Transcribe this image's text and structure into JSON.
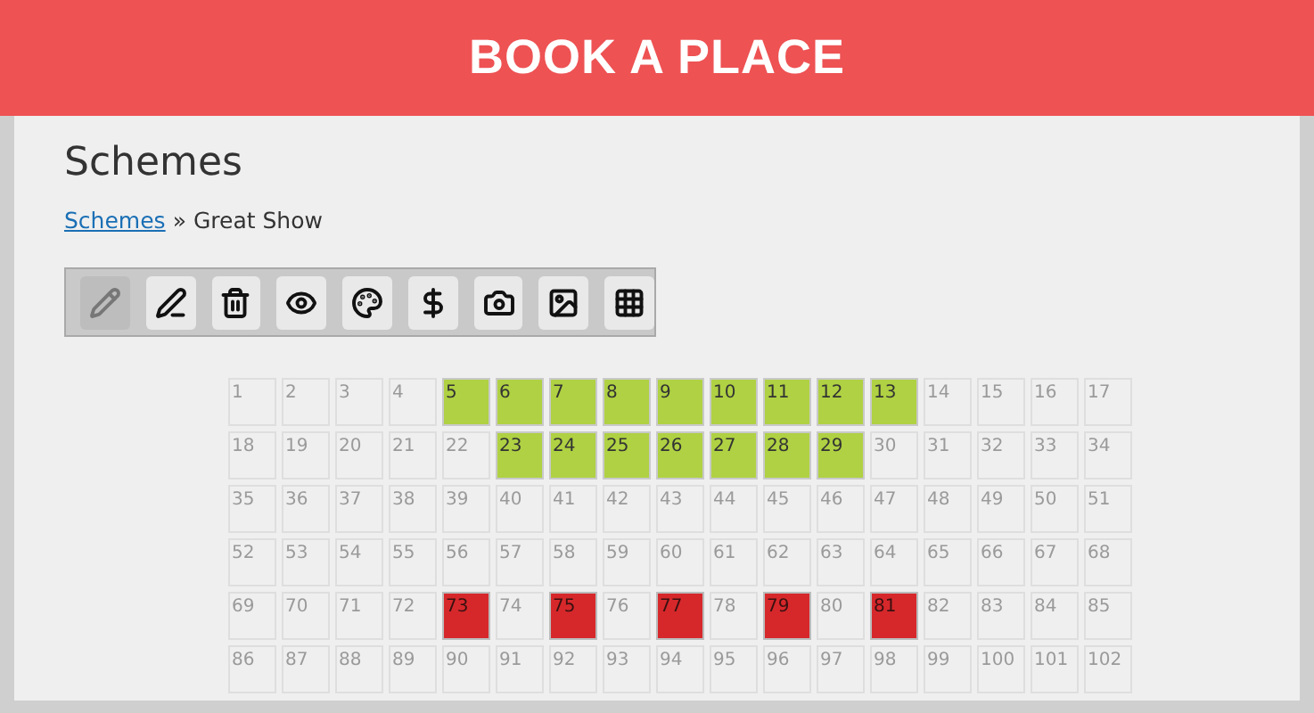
{
  "header": {
    "title": "BOOK A PLACE"
  },
  "page": {
    "heading": "Schemes",
    "breadcrumb": {
      "link": "Schemes",
      "separator": "»",
      "current": "Great Show"
    }
  },
  "toolbar": [
    {
      "kind": "pencil",
      "disabled": true
    },
    {
      "kind": "edit",
      "disabled": false
    },
    {
      "kind": "trash",
      "disabled": false
    },
    {
      "kind": "eye",
      "disabled": false
    },
    {
      "kind": "palette",
      "disabled": false
    },
    {
      "kind": "dollar",
      "disabled": false
    },
    {
      "kind": "camera",
      "disabled": false
    },
    {
      "kind": "image",
      "disabled": false
    },
    {
      "kind": "grid",
      "disabled": false
    }
  ],
  "seats": [
    {
      "label": "1",
      "selected": false,
      "booked": false
    },
    {
      "label": "2",
      "selected": false,
      "booked": false
    },
    {
      "label": "3",
      "selected": false,
      "booked": false
    },
    {
      "label": "4",
      "selected": false,
      "booked": false
    },
    {
      "label": "5",
      "selected": true,
      "booked": false
    },
    {
      "label": "6",
      "selected": true,
      "booked": false
    },
    {
      "label": "7",
      "selected": true,
      "booked": false
    },
    {
      "label": "8",
      "selected": true,
      "booked": false
    },
    {
      "label": "9",
      "selected": true,
      "booked": false
    },
    {
      "label": "10",
      "selected": true,
      "booked": false
    },
    {
      "label": "11",
      "selected": true,
      "booked": false
    },
    {
      "label": "12",
      "selected": true,
      "booked": false
    },
    {
      "label": "13",
      "selected": true,
      "booked": false
    },
    {
      "label": "14",
      "selected": false,
      "booked": false
    },
    {
      "label": "15",
      "selected": false,
      "booked": false
    },
    {
      "label": "16",
      "selected": false,
      "booked": false
    },
    {
      "label": "17",
      "selected": false,
      "booked": false
    },
    {
      "label": "18",
      "selected": false,
      "booked": false
    },
    {
      "label": "19",
      "selected": false,
      "booked": false
    },
    {
      "label": "20",
      "selected": false,
      "booked": false
    },
    {
      "label": "21",
      "selected": false,
      "booked": false
    },
    {
      "label": "22",
      "selected": false,
      "booked": false
    },
    {
      "label": "23",
      "selected": true,
      "booked": false
    },
    {
      "label": "24",
      "selected": true,
      "booked": false
    },
    {
      "label": "25",
      "selected": true,
      "booked": false
    },
    {
      "label": "26",
      "selected": true,
      "booked": false
    },
    {
      "label": "27",
      "selected": true,
      "booked": false
    },
    {
      "label": "28",
      "selected": true,
      "booked": false
    },
    {
      "label": "29",
      "selected": true,
      "booked": false
    },
    {
      "label": "30",
      "selected": false,
      "booked": false
    },
    {
      "label": "31",
      "selected": false,
      "booked": false
    },
    {
      "label": "32",
      "selected": false,
      "booked": false
    },
    {
      "label": "33",
      "selected": false,
      "booked": false
    },
    {
      "label": "34",
      "selected": false,
      "booked": false
    },
    {
      "label": "35",
      "selected": false,
      "booked": false
    },
    {
      "label": "36",
      "selected": false,
      "booked": false
    },
    {
      "label": "37",
      "selected": false,
      "booked": false
    },
    {
      "label": "38",
      "selected": false,
      "booked": false
    },
    {
      "label": "39",
      "selected": false,
      "booked": false
    },
    {
      "label": "40",
      "selected": false,
      "booked": false
    },
    {
      "label": "41",
      "selected": false,
      "booked": false
    },
    {
      "label": "42",
      "selected": false,
      "booked": false
    },
    {
      "label": "43",
      "selected": false,
      "booked": false
    },
    {
      "label": "44",
      "selected": false,
      "booked": false
    },
    {
      "label": "45",
      "selected": false,
      "booked": false
    },
    {
      "label": "46",
      "selected": false,
      "booked": false
    },
    {
      "label": "47",
      "selected": false,
      "booked": false
    },
    {
      "label": "48",
      "selected": false,
      "booked": false
    },
    {
      "label": "49",
      "selected": false,
      "booked": false
    },
    {
      "label": "50",
      "selected": false,
      "booked": false
    },
    {
      "label": "51",
      "selected": false,
      "booked": false
    },
    {
      "label": "52",
      "selected": false,
      "booked": false
    },
    {
      "label": "53",
      "selected": false,
      "booked": false
    },
    {
      "label": "54",
      "selected": false,
      "booked": false
    },
    {
      "label": "55",
      "selected": false,
      "booked": false
    },
    {
      "label": "56",
      "selected": false,
      "booked": false
    },
    {
      "label": "57",
      "selected": false,
      "booked": false
    },
    {
      "label": "58",
      "selected": false,
      "booked": false
    },
    {
      "label": "59",
      "selected": false,
      "booked": false
    },
    {
      "label": "60",
      "selected": false,
      "booked": false
    },
    {
      "label": "61",
      "selected": false,
      "booked": false
    },
    {
      "label": "62",
      "selected": false,
      "booked": false
    },
    {
      "label": "63",
      "selected": false,
      "booked": false
    },
    {
      "label": "64",
      "selected": false,
      "booked": false
    },
    {
      "label": "65",
      "selected": false,
      "booked": false
    },
    {
      "label": "66",
      "selected": false,
      "booked": false
    },
    {
      "label": "67",
      "selected": false,
      "booked": false
    },
    {
      "label": "68",
      "selected": false,
      "booked": false
    },
    {
      "label": "69",
      "selected": false,
      "booked": false
    },
    {
      "label": "70",
      "selected": false,
      "booked": false
    },
    {
      "label": "71",
      "selected": false,
      "booked": false
    },
    {
      "label": "72",
      "selected": false,
      "booked": false
    },
    {
      "label": "73",
      "selected": false,
      "booked": true
    },
    {
      "label": "74",
      "selected": false,
      "booked": false
    },
    {
      "label": "75",
      "selected": false,
      "booked": true
    },
    {
      "label": "76",
      "selected": false,
      "booked": false
    },
    {
      "label": "77",
      "selected": false,
      "booked": true
    },
    {
      "label": "78",
      "selected": false,
      "booked": false
    },
    {
      "label": "79",
      "selected": false,
      "booked": true
    },
    {
      "label": "80",
      "selected": false,
      "booked": false
    },
    {
      "label": "81",
      "selected": false,
      "booked": true
    },
    {
      "label": "82",
      "selected": false,
      "booked": false
    },
    {
      "label": "83",
      "selected": false,
      "booked": false
    },
    {
      "label": "84",
      "selected": false,
      "booked": false
    },
    {
      "label": "85",
      "selected": false,
      "booked": false
    },
    {
      "label": "86",
      "selected": false,
      "booked": false
    },
    {
      "label": "87",
      "selected": false,
      "booked": false
    },
    {
      "label": "88",
      "selected": false,
      "booked": false
    },
    {
      "label": "89",
      "selected": false,
      "booked": false
    },
    {
      "label": "90",
      "selected": false,
      "booked": false
    },
    {
      "label": "91",
      "selected": false,
      "booked": false
    },
    {
      "label": "92",
      "selected": false,
      "booked": false
    },
    {
      "label": "93",
      "selected": false,
      "booked": false
    },
    {
      "label": "94",
      "selected": false,
      "booked": false
    },
    {
      "label": "95",
      "selected": false,
      "booked": false
    },
    {
      "label": "96",
      "selected": false,
      "booked": false
    },
    {
      "label": "97",
      "selected": false,
      "booked": false
    },
    {
      "label": "98",
      "selected": false,
      "booked": false
    },
    {
      "label": "99",
      "selected": false,
      "booked": false
    },
    {
      "label": "100",
      "selected": false,
      "booked": false
    },
    {
      "label": "101",
      "selected": false,
      "booked": false
    },
    {
      "label": "102",
      "selected": false,
      "booked": false
    }
  ]
}
